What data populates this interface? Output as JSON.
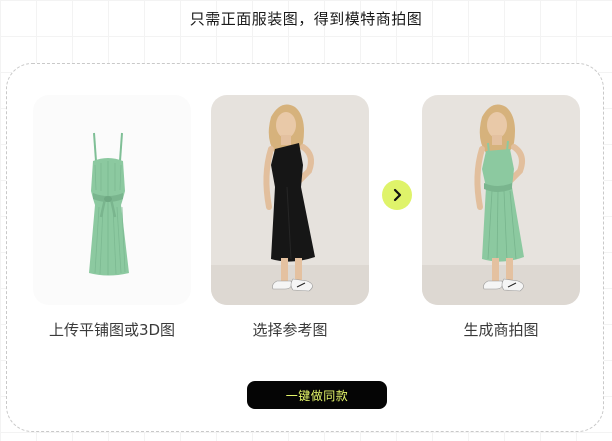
{
  "header": {
    "title": "只需正面服装图，得到模特商拍图"
  },
  "steps": [
    {
      "label": "上传平铺图或3D图",
      "image": "green-pleated-dress-flat-lay"
    },
    {
      "label": "选择参考图",
      "image": "model-black-dress-reference"
    },
    {
      "label": "生成商拍图",
      "image": "model-green-dress-result"
    }
  ],
  "arrow": {
    "icon": "chevron-right-icon"
  },
  "cta": {
    "label": "一键做同款"
  },
  "colors": {
    "accent": "#dff36a",
    "cta_bg": "#050505",
    "cta_text": "#e8f96b",
    "dress_green": "#8cc9a0"
  }
}
